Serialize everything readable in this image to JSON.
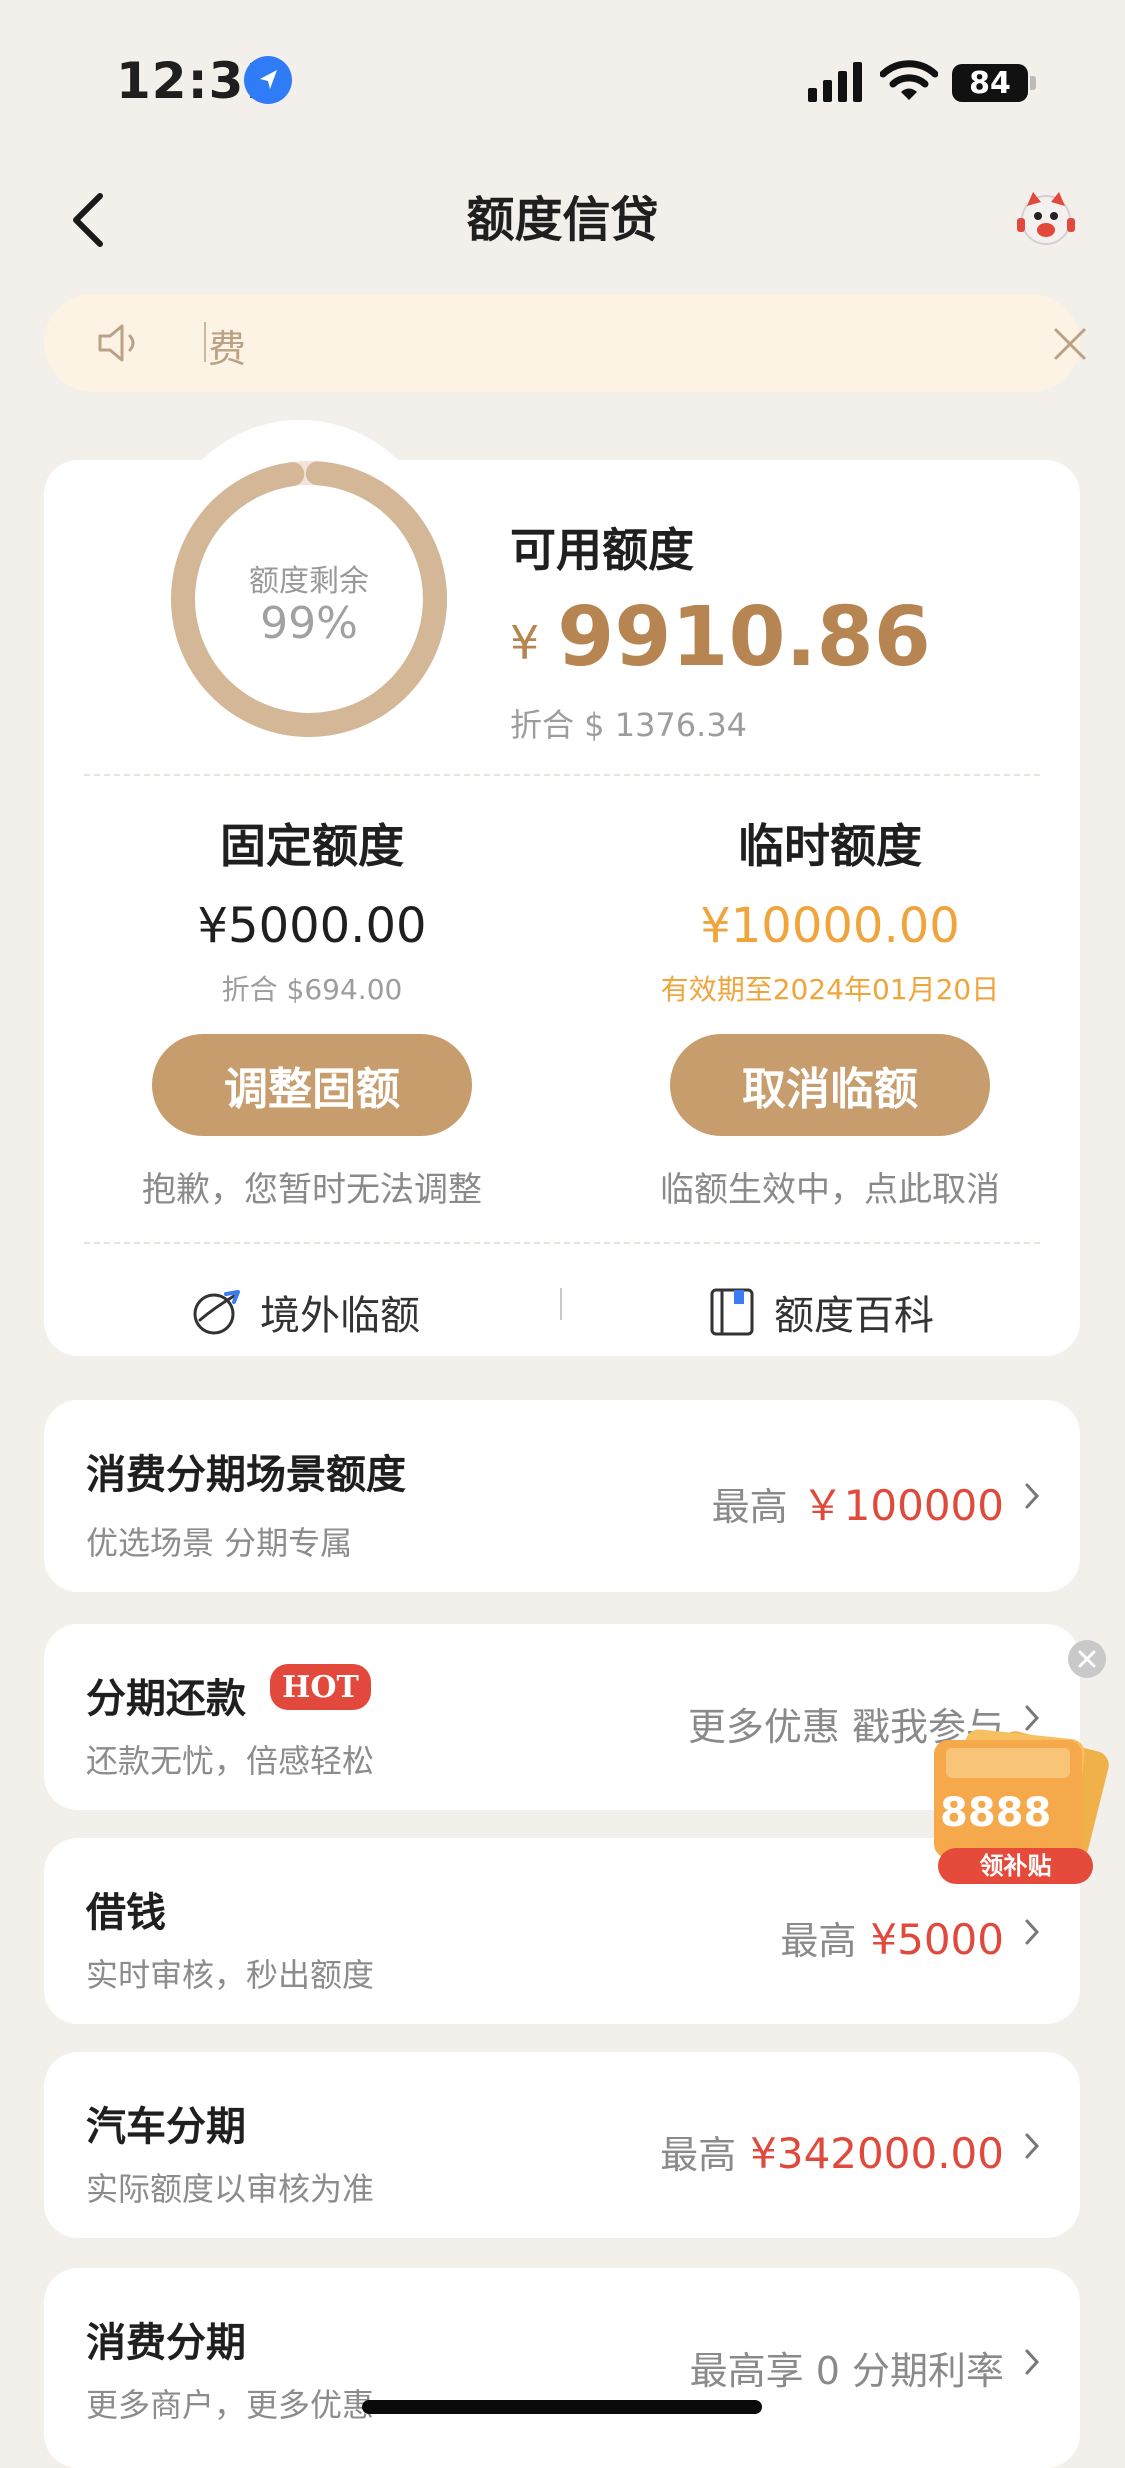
{
  "status_bar": {
    "time": "12:31",
    "battery": "84"
  },
  "nav": {
    "title": "额度信贷"
  },
  "notice": {
    "text": "费"
  },
  "summary": {
    "ring_label": "额度剩余",
    "ring_percent": "99%",
    "ring_fraction": 0.99,
    "available_title": "可用额度",
    "available_currency": "¥",
    "available_amount": "9910.86",
    "available_converted": "折合 $ 1376.34",
    "fixed": {
      "title": "固定额度",
      "amount": "¥5000.00",
      "converted": "折合 $694.00",
      "button": "调整固额",
      "note": "抱歉，您暂时无法调整"
    },
    "temporary": {
      "title": "临时额度",
      "amount": "¥10000.00",
      "validity": "有效期至2024年01月20日",
      "button": "取消临额",
      "note": "临额生效中，点此取消"
    },
    "footer": {
      "overseas": "境外临额",
      "wiki": "额度百科"
    }
  },
  "cards": [
    {
      "title": "消费分期场景额度",
      "subtitle": "优选场景 分期专属",
      "prefix": "最高",
      "value": "￥100000"
    },
    {
      "title": "分期还款",
      "badge": "HOT",
      "subtitle": "还款无忧，倍感轻松",
      "prefix": "更多优惠 戳我参与",
      "value": ""
    },
    {
      "title": "借钱",
      "subtitle": "实时审核，秒出额度",
      "prefix": "最高",
      "value": "¥5000"
    },
    {
      "title": "汽车分期",
      "subtitle": "实际额度以审核为准",
      "prefix": "最高",
      "value": "¥342000.00"
    },
    {
      "title": "消费分期",
      "subtitle": "更多商户，更多优惠",
      "prefix": "最高享 0 分期利率",
      "value": ""
    }
  ],
  "float_badge": {
    "amount": "8888",
    "label": "领补贴"
  },
  "colors": {
    "accent": "#c79d6d",
    "gold_text": "#b68552",
    "orange": "#efa53c",
    "red": "#e04a3c",
    "background": "#f3efea"
  }
}
